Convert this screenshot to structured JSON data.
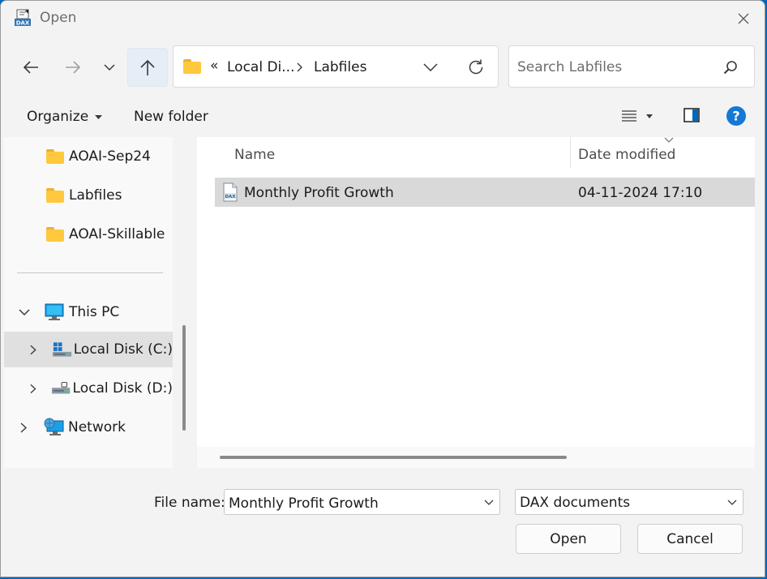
{
  "window": {
    "title": "Open"
  },
  "address": {
    "overflow": "«",
    "segments": [
      "Local Di...",
      "Labfiles"
    ]
  },
  "search": {
    "placeholder": "Search Labfiles"
  },
  "toolbar": {
    "organize_label": "Organize",
    "new_folder_label": "New folder"
  },
  "sidebar": {
    "items": [
      {
        "label": "AOAI-Sep24",
        "icon": "folder-icon"
      },
      {
        "label": "Labfiles",
        "icon": "folder-icon"
      },
      {
        "label": "AOAI-Skillable",
        "icon": "folder-icon"
      },
      {
        "label": "This PC",
        "icon": "pc-icon"
      },
      {
        "label": "Local Disk (C:)",
        "icon": "windows-drive-icon"
      },
      {
        "label": "Local Disk (D:)",
        "icon": "drive-icon"
      },
      {
        "label": "Network",
        "icon": "network-icon"
      }
    ]
  },
  "columns": {
    "name": "Name",
    "date": "Date modified"
  },
  "files": [
    {
      "name": "Monthly Profit Growth",
      "date": "04-11-2024 17:10",
      "icon": "dax-file-icon"
    }
  ],
  "footer": {
    "file_name_label": "File name:",
    "file_name_value": "Monthly Profit Growth",
    "file_type": "DAX documents",
    "open_label": "Open",
    "cancel_label": "Cancel"
  },
  "colors": {
    "accent": "#0067c0",
    "help": "#1478d4",
    "folder": "#ffc83d",
    "selected": "#d9d9d9"
  }
}
